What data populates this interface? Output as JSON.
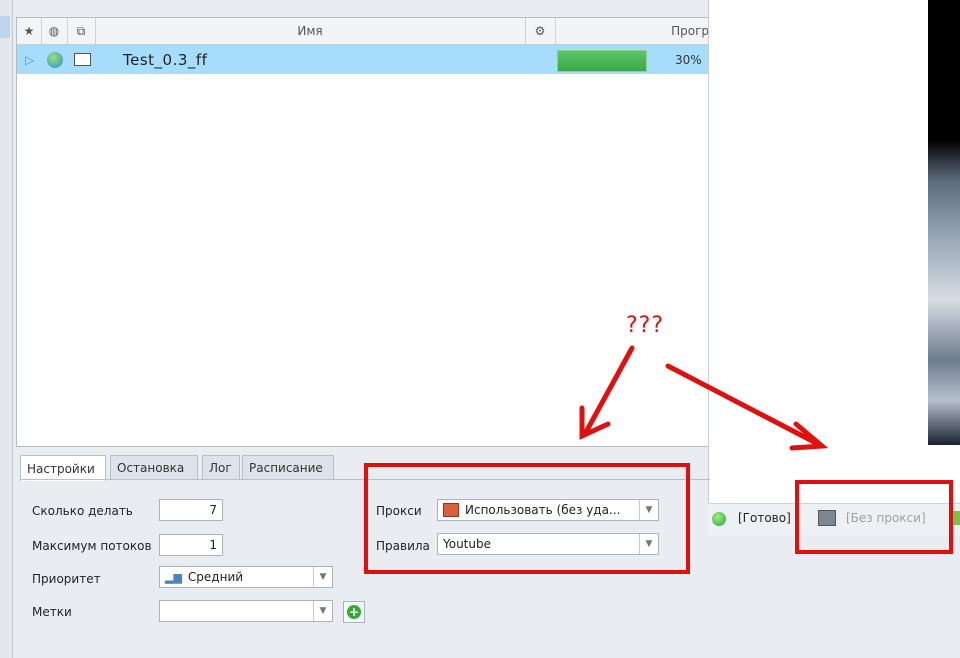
{
  "grid": {
    "header": {
      "name_col": "Имя",
      "progress_col": "Прогр"
    },
    "rows": [
      {
        "name": "Test_0.3_ff",
        "progress": "30%",
        "progress_fraction": 0.3
      }
    ]
  },
  "status": {
    "ready": "[Готово]",
    "proxy": "[Без прокси]"
  },
  "tabs": [
    "Настройки",
    "Остановка",
    "Лог",
    "Расписание"
  ],
  "settings": {
    "count_label": "Сколько делать",
    "count_value": "7",
    "threads_label": "Максимум потоков",
    "threads_value": "1",
    "priority_label": "Приоритет",
    "priority_value": "Средний",
    "tags_label": "Метки",
    "tags_value": ""
  },
  "proxy": {
    "label": "Прокси",
    "value": "Использовать (без уда...",
    "rules_label": "Правила",
    "rules_value": "Youtube"
  },
  "annotation": {
    "text": "???"
  },
  "colors": {
    "accent_red": "#e01010",
    "row_selected": "#a6ddfb",
    "progress_green": "#37a944"
  }
}
